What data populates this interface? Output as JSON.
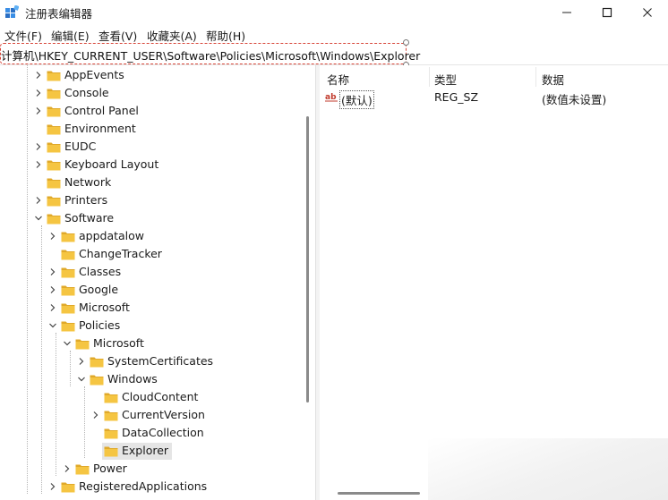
{
  "window": {
    "title": "注册表编辑器",
    "icon": "registry-editor-icon"
  },
  "menu": [
    "文件(F)",
    "编辑(E)",
    "查看(V)",
    "收藏夹(A)",
    "帮助(H)"
  ],
  "address": "计算机\\HKEY_CURRENT_USER\\Software\\Policies\\Microsoft\\Windows\\Explorer",
  "tree": [
    {
      "label": "AppEvents",
      "level": 1,
      "expander": "collapsed"
    },
    {
      "label": "Console",
      "level": 1,
      "expander": "collapsed"
    },
    {
      "label": "Control Panel",
      "level": 1,
      "expander": "collapsed"
    },
    {
      "label": "Environment",
      "level": 1,
      "expander": "none"
    },
    {
      "label": "EUDC",
      "level": 1,
      "expander": "collapsed"
    },
    {
      "label": "Keyboard Layout",
      "level": 1,
      "expander": "collapsed"
    },
    {
      "label": "Network",
      "level": 1,
      "expander": "none"
    },
    {
      "label": "Printers",
      "level": 1,
      "expander": "collapsed"
    },
    {
      "label": "Software",
      "level": 1,
      "expander": "expanded"
    },
    {
      "label": "appdatalow",
      "level": 2,
      "expander": "collapsed"
    },
    {
      "label": "ChangeTracker",
      "level": 2,
      "expander": "none"
    },
    {
      "label": "Classes",
      "level": 2,
      "expander": "collapsed"
    },
    {
      "label": "Google",
      "level": 2,
      "expander": "collapsed"
    },
    {
      "label": "Microsoft",
      "level": 2,
      "expander": "collapsed"
    },
    {
      "label": "Policies",
      "level": 2,
      "expander": "expanded"
    },
    {
      "label": "Microsoft",
      "level": 3,
      "expander": "expanded"
    },
    {
      "label": "SystemCertificates",
      "level": 4,
      "expander": "collapsed"
    },
    {
      "label": "Windows",
      "level": 4,
      "expander": "expanded"
    },
    {
      "label": "CloudContent",
      "level": 5,
      "expander": "none"
    },
    {
      "label": "CurrentVersion",
      "level": 5,
      "expander": "collapsed"
    },
    {
      "label": "DataCollection",
      "level": 5,
      "expander": "none"
    },
    {
      "label": "Explorer",
      "level": 5,
      "expander": "none",
      "selected": true
    },
    {
      "label": "Power",
      "level": 3,
      "expander": "collapsed"
    },
    {
      "label": "RegisteredApplications",
      "level": 2,
      "expander": "collapsed"
    }
  ],
  "values_pane": {
    "headers": {
      "name": "名称",
      "type": "类型",
      "data": "数据"
    },
    "rows": [
      {
        "icon": "string-value-icon",
        "name": "(默认)",
        "type": "REG_SZ",
        "data": "(数值未设置)"
      }
    ]
  },
  "colors": {
    "folder": "#f5c542",
    "folder_dark": "#e0a92a",
    "address_highlight": "#d8473a",
    "selection": "#e5e5e5"
  }
}
